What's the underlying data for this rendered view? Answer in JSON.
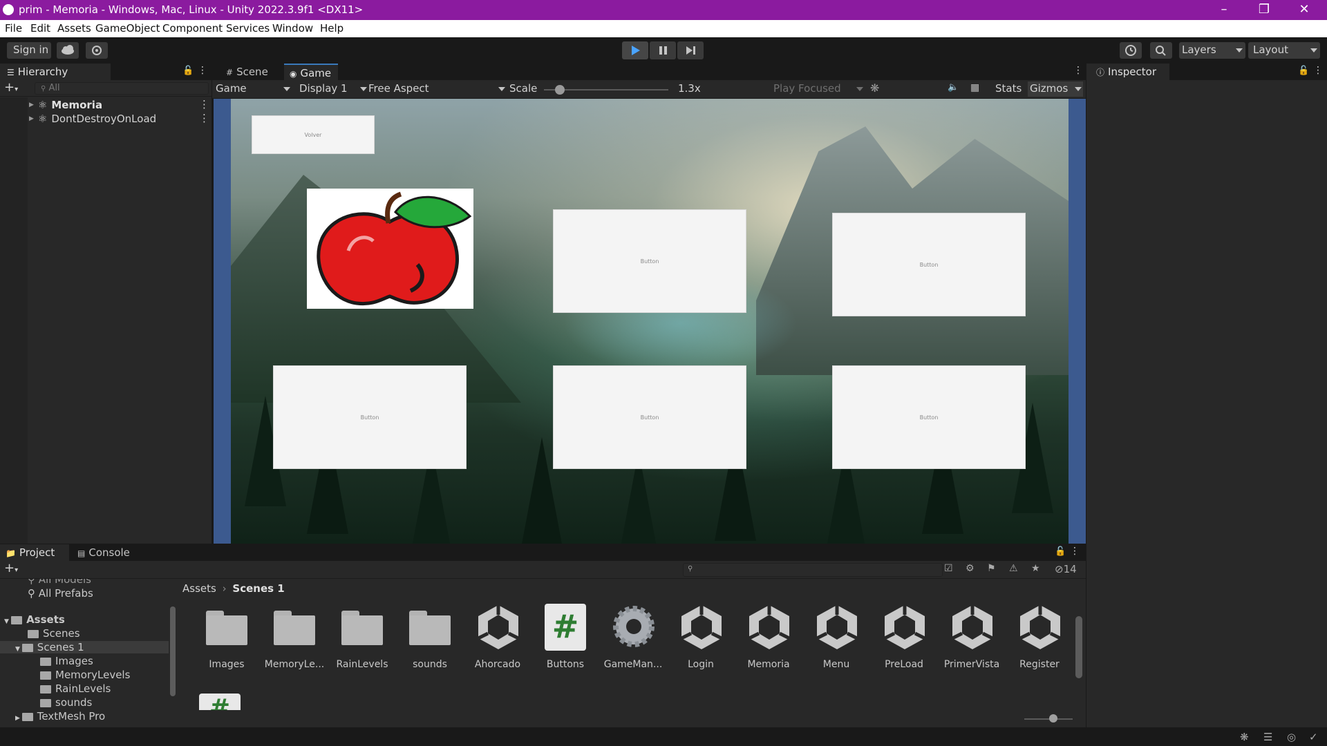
{
  "window": {
    "title": "prim - Memoria - Windows, Mac, Linux - Unity 2022.3.9f1 <DX11>",
    "controls": [
      "minimize-icon",
      "restore-icon",
      "close-icon"
    ]
  },
  "menu": [
    "File",
    "Edit",
    "Assets",
    "GameObject",
    "Component",
    "Services",
    "Window",
    "Help"
  ],
  "toolbar": {
    "sign_in": "Sign in",
    "layers": "Layers",
    "layout": "Layout"
  },
  "hierarchy": {
    "tab": "Hierarchy",
    "search_placeholder": "All",
    "items": [
      {
        "label": "Memoria"
      },
      {
        "label": "DontDestroyOnLoad"
      }
    ]
  },
  "scene_tabs": [
    "Scene",
    "Game"
  ],
  "game_bar": {
    "mode": "Game",
    "display": "Display 1",
    "aspect": "Free Aspect",
    "scale_label": "Scale",
    "scale_value": 0.13,
    "scale_text": "1.3x",
    "play_focused": "Play Focused",
    "stats": "Stats",
    "gizmos": "Gizmos"
  },
  "game": {
    "top_button": "Volver",
    "cards": [
      "Button",
      "Button",
      "Button",
      "Button",
      "Button"
    ]
  },
  "inspector": {
    "tab": "Inspector"
  },
  "bottom_tabs": [
    "Project",
    "Console"
  ],
  "project": {
    "hidden_count": "14",
    "tree": [
      {
        "label": "All Models"
      },
      {
        "label": "All Prefabs"
      },
      {
        "label": "Assets"
      },
      {
        "label": "Scenes"
      },
      {
        "label": "Scenes 1"
      },
      {
        "label": "Images"
      },
      {
        "label": "MemoryLevels"
      },
      {
        "label": "RainLevels"
      },
      {
        "label": "sounds"
      },
      {
        "label": "TextMesh Pro"
      }
    ],
    "breadcrumb": [
      "Assets",
      "Scenes 1"
    ],
    "assets": [
      {
        "label": "Images",
        "kind": "folder"
      },
      {
        "label": "MemoryLe...",
        "kind": "folder"
      },
      {
        "label": "RainLevels",
        "kind": "folder"
      },
      {
        "label": "sounds",
        "kind": "folder"
      },
      {
        "label": "Ahorcado",
        "kind": "scene"
      },
      {
        "label": "Buttons",
        "kind": "script"
      },
      {
        "label": "GameMan...",
        "kind": "gear"
      },
      {
        "label": "Login",
        "kind": "scene"
      },
      {
        "label": "Memoria",
        "kind": "scene"
      },
      {
        "label": "Menu",
        "kind": "scene"
      },
      {
        "label": "PreLoad",
        "kind": "scene"
      },
      {
        "label": "PrimerVista",
        "kind": "scene"
      },
      {
        "label": "Register",
        "kind": "scene"
      }
    ]
  },
  "colors": {
    "titlebar": "#8b1b9f",
    "accent": "#3a79bb",
    "script_green": "#2e7d32"
  }
}
